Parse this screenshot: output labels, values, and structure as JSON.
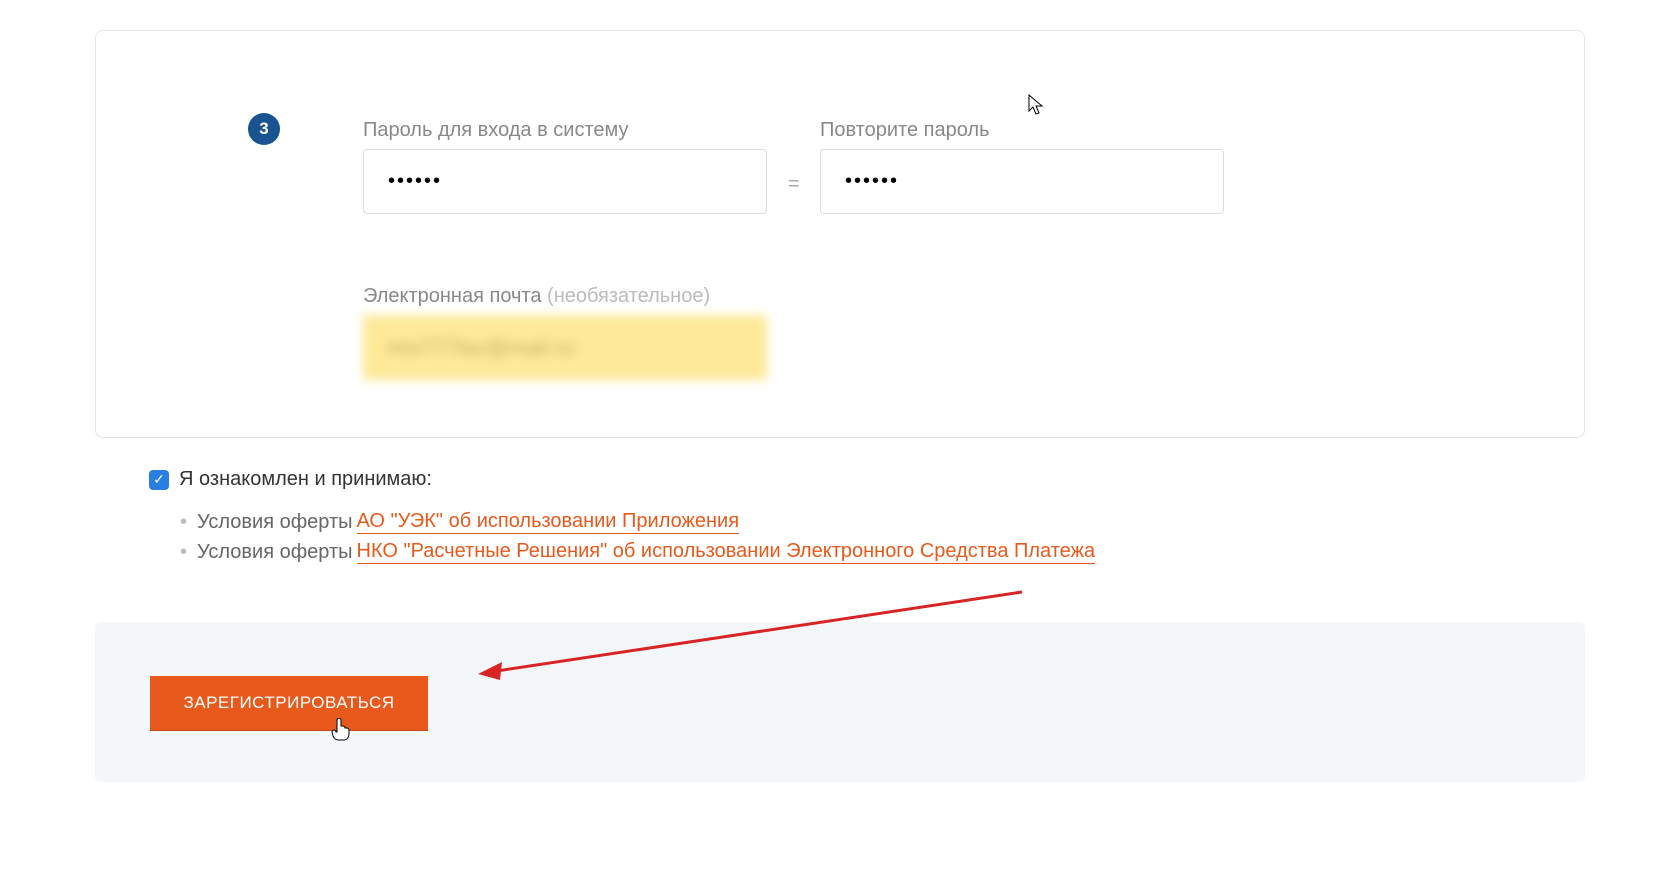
{
  "step": {
    "number": "3"
  },
  "password": {
    "label": "Пароль для входа в систему",
    "value": "••••••"
  },
  "equals": "=",
  "password2": {
    "label": "Повторите пароль",
    "value": "••••••"
  },
  "email": {
    "label": "Электронная почта ",
    "optional": "(необязательное)",
    "value": "mix777lav@mail.ru"
  },
  "agreement": {
    "checked": true,
    "label": "Я ознакомлен и принимаю:"
  },
  "terms": {
    "item1_prefix": "Условия оферты",
    "item1_link": " АО \"УЭК\" об использовании Приложения",
    "item2_prefix": "Условия оферты",
    "item2_link": " НКО \"Расчетные Решения\" об использовании Электронного Средства Платежа"
  },
  "submit": {
    "label": "ЗАРЕГИСТРИРОВАТЬСЯ"
  }
}
